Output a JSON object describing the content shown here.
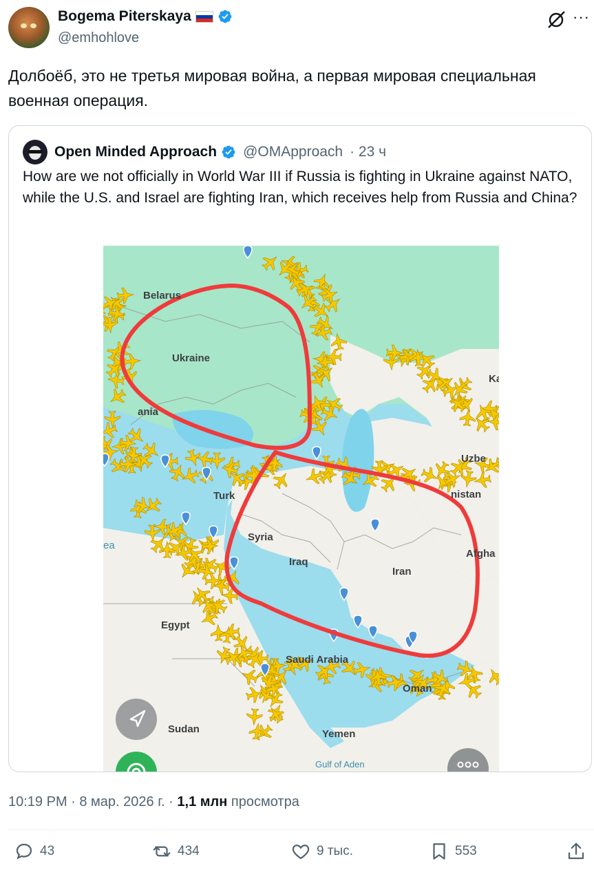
{
  "author": {
    "name": "Bogema Piterskaya",
    "handle": "@emhohlove"
  },
  "post": {
    "text": "Долбоёб, это не третья мировая война, а первая мировая специальная военная операция."
  },
  "quoted": {
    "name": "Open Minded Approach",
    "handle": "@OMApproach",
    "time": "· 23 ч",
    "text": "How are we not officially in World War III if Russia is fighting in Ukraine against NATO, while the U.S. and Israel are fighting Iran, which receives help from Russia and China?",
    "map_labels": {
      "belarus": "Belarus",
      "ukraine": "Ukraine",
      "romania": "ania",
      "kaz": "Ka",
      "uzbek": "Uzbe",
      "turkmenistan": "nistan",
      "turkey": "Turk",
      "sea": "ea",
      "syria": "Syria",
      "iraq": "Iraq",
      "iran": "Iran",
      "afghan": "Afgha",
      "egypt": "Egypt",
      "saudi": "Saudi Arabia",
      "oman": "Oman",
      "sudan": "Sudan",
      "yemen": "Yemen",
      "gulf": "Gulf of Aden"
    }
  },
  "meta": {
    "time": "10:19 PM · 8 мар. 2026 г. · ",
    "views_count": "1,1 млн",
    "views_label": " просмотра"
  },
  "actions": {
    "replies": "43",
    "reposts": "434",
    "likes": "9 тыс.",
    "bookmarks": "553"
  },
  "colors": {
    "accent": "#1d9bf0",
    "circle": "#ef3b3b",
    "plane": "#f5c800",
    "water": "#9bdced",
    "land": "#f2f0ea",
    "green": "#a8e6c9"
  }
}
